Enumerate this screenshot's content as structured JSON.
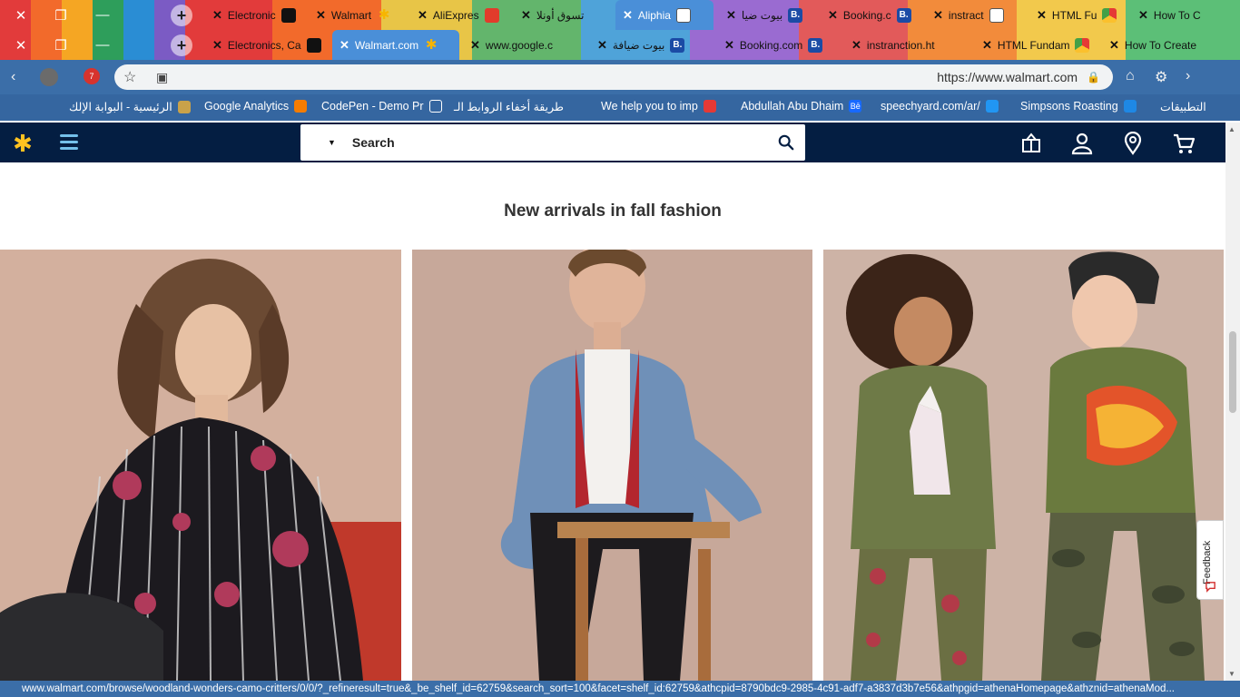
{
  "browser": {
    "tabs_row1": [
      {
        "label": "Electronic",
        "favicon": "shopping-bag-icon"
      },
      {
        "label": "Walmart",
        "favicon": "walmart-spark-icon"
      },
      {
        "label": "AliExpres",
        "favicon": "aliexpress-icon"
      },
      {
        "label": "تسوق أونلا",
        "favicon": "store-icon"
      },
      {
        "label": "Aliphia",
        "favicon": "document-icon",
        "active": true
      },
      {
        "label": "بيوت ضيا",
        "favicon": "booking-icon"
      },
      {
        "label": "Booking.c",
        "favicon": "booking-icon"
      },
      {
        "label": "instract",
        "favicon": "document-icon"
      },
      {
        "label": "HTML Fu",
        "favicon": "chrome-icon"
      },
      {
        "label": "How To C",
        "favicon": "extension-icon"
      }
    ],
    "tabs_row2": [
      {
        "label": "Electronics, Ca",
        "favicon": "shopping-bag-icon"
      },
      {
        "label": "Walmart.com",
        "favicon": "walmart-spark-icon",
        "active": true
      },
      {
        "label": "www.google.c",
        "favicon": "google-icon"
      },
      {
        "label": "بيوت ضيافة",
        "favicon": "booking-icon"
      },
      {
        "label": "Booking.com",
        "favicon": "booking-icon"
      },
      {
        "label": "instranction.ht",
        "favicon": "document-icon"
      },
      {
        "label": "HTML Fundam",
        "favicon": "chrome-icon"
      },
      {
        "label": "How To Create",
        "favicon": "extension-icon"
      }
    ],
    "address": {
      "url": "https://www.walmart.com",
      "extension_badge": "7"
    },
    "bookmarks": [
      {
        "label": "الرئيسية - البوابة الإلك"
      },
      {
        "label": "Google Analytics"
      },
      {
        "label": "CodePen - Demo Pr"
      },
      {
        "label": "طريقة أخفاء الروابط الـ"
      },
      {
        "label": "We help you to imp"
      },
      {
        "label": "Abdullah Abu Dhaim"
      },
      {
        "label": "speechyard.com/ar/"
      },
      {
        "label": "Simpsons Roasting"
      },
      {
        "label": "التطبيقات"
      }
    ],
    "status_url": "www.walmart.com/browse/woodland-wonders-camo-critters/0/0/?_refineresult=true&_be_shelf_id=62759&search_sort=100&facet=shelf_id:62759&athcpid=8790bdc9-2985-4c91-adf7-a3837d3b7e56&athpgid=athenaHomepage&athznid=athenaMod..."
  },
  "walmart": {
    "search": {
      "placeholder": "Search"
    },
    "section_title": "New arrivals in fall fashion",
    "cards": [
      {
        "name": "women-fall-fashion-card"
      },
      {
        "name": "men-fall-fashion-card"
      },
      {
        "name": "kids-fall-fashion-card"
      }
    ],
    "feedback_label": "Feedback"
  },
  "colors": {
    "walmart_blue": "#041e42",
    "walmart_yellow": "#ffc220",
    "walmart_light_blue": "#74c0ea",
    "browser_blue": "#3b6ea8"
  }
}
